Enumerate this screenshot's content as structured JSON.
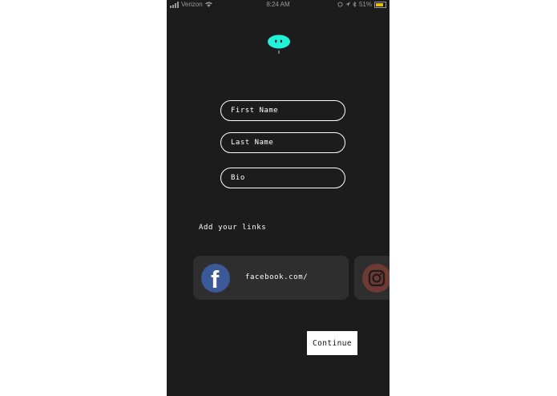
{
  "status_bar": {
    "carrier": "Verizon",
    "time": "8:24 AM",
    "battery": "51%"
  },
  "form": {
    "first_name_placeholder": "First Name",
    "last_name_placeholder": "Last Name",
    "bio_placeholder": "Bio"
  },
  "links": {
    "heading": "Add your links",
    "facebook_prefix": "facebook.com/"
  },
  "continue_label": "Continue",
  "colors": {
    "background": "#1c1c1c",
    "card": "#2e2e2e",
    "accent": "#1ef2d8",
    "facebook": "#3b5998",
    "instagram": "#6e3a33"
  }
}
